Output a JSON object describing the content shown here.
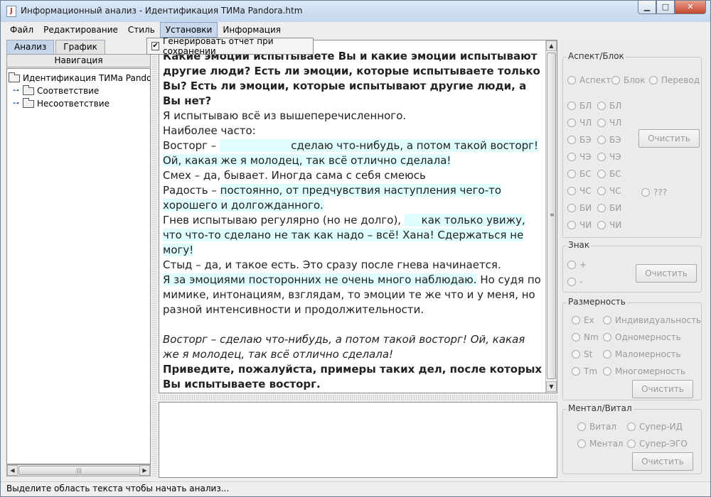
{
  "window": {
    "title": "Информационный анализ - Идентификация ТИМа Pandora.htm",
    "icon_symbol": "J",
    "controls": {
      "minimize": "▁",
      "maximize": "□",
      "close": "✕"
    }
  },
  "menu": {
    "items": [
      "Файл",
      "Редактирование",
      "Стиль",
      "Установки",
      "Информация"
    ],
    "active_index": 3,
    "dropdown": {
      "checked": true,
      "check_mark": "✔",
      "label": "Генерировать отчет при сохранении"
    }
  },
  "left": {
    "tabs": [
      "Анализ",
      "График"
    ],
    "selected_tab": 0,
    "nav_header": "Навигация",
    "tree": {
      "root": "Идентификация ТИМа Pandora",
      "children": [
        "Соответствие",
        "Несоответствие"
      ],
      "expander_glyph": "⊶"
    },
    "hscroll": {
      "left_arrow": "◀",
      "right_arrow": "▶",
      "grip": "|||"
    }
  },
  "text": {
    "scroll": {
      "up": "▲",
      "down": "▼",
      "grip": "≡"
    }
  },
  "right": {
    "aspect_block": {
      "title": "Аспект/Блок",
      "modes": [
        "Аспект",
        "Блок",
        "Перевод"
      ],
      "col1": [
        "БЛ",
        "ЧЛ",
        "БЭ",
        "ЧЭ",
        "БС",
        "ЧС",
        "БИ",
        "ЧИ"
      ],
      "col2": [
        "БЛ",
        "ЧЛ",
        "БЭ",
        "ЧЭ",
        "БС",
        "ЧС",
        "БИ",
        "ЧИ"
      ],
      "unknown": "???",
      "clear": "Очистить"
    },
    "sign": {
      "title": "Знак",
      "options": [
        "+",
        "-"
      ],
      "clear": "Очистить"
    },
    "dimension": {
      "title": "Размерность",
      "col1": [
        "Ex",
        "Nm",
        "St",
        "Tm"
      ],
      "col2": [
        "Индивидуальность",
        "Одномерность",
        "Маломерность",
        "Многомерность"
      ],
      "clear": "Очистить"
    },
    "mental": {
      "title": "Ментал/Витал",
      "options": [
        "Витал",
        "Супер-ИД",
        "Ментал",
        "Супер-ЭГО"
      ],
      "clear": "Очистить"
    }
  },
  "status": "Выделите область текста чтобы начать анализ..."
}
